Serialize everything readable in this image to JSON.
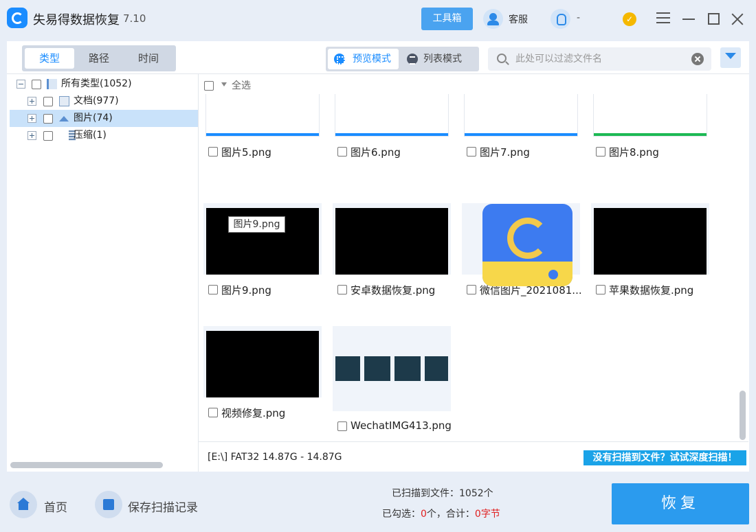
{
  "app": {
    "title": "失易得数据恢复",
    "version": "7.10"
  },
  "header": {
    "toolbox_label": "工具箱",
    "service_label": "客服",
    "qq_label": "-",
    "vip_glyph": "✓"
  },
  "side_tabs": [
    {
      "label": "类型",
      "active": true
    },
    {
      "label": "路径",
      "active": false
    },
    {
      "label": "时间",
      "active": false
    }
  ],
  "view_modes": [
    {
      "label": "预览模式",
      "active": true
    },
    {
      "label": "列表模式",
      "active": false
    }
  ],
  "search": {
    "placeholder": "此处可以过滤文件名",
    "value": ""
  },
  "tree": {
    "root": {
      "label": "所有类型(1052)"
    },
    "children": [
      {
        "label": "文档(977)",
        "selected": false
      },
      {
        "label": "图片(74)",
        "selected": true
      },
      {
        "label": "压缩(1)",
        "selected": false
      }
    ]
  },
  "grid": {
    "select_all_label": "全选",
    "files": [
      {
        "name": "图片5.png",
        "thumb": "screenshot"
      },
      {
        "name": "图片6.png",
        "thumb": "screenshot"
      },
      {
        "name": "图片7.png",
        "thumb": "screenshot"
      },
      {
        "name": "图片8.png",
        "thumb": "screenshot"
      },
      {
        "name": "图片9.png",
        "thumb": "black"
      },
      {
        "name": "安卓数据恢复.png",
        "thumb": "black"
      },
      {
        "name": "微信图片_2021081...",
        "thumb": "app-icon"
      },
      {
        "name": "苹果数据恢复.png",
        "thumb": "black"
      },
      {
        "name": "视频修复.png",
        "thumb": "black"
      },
      {
        "name": "WechatIMG413.png",
        "thumb": "dark-slides"
      }
    ],
    "tooltip": "图片9.png"
  },
  "status": {
    "disk_info": "[E:\\] FAT32 14.87G - 14.87G",
    "deep_scan_label": "没有扫描到文件？试试深度扫描！"
  },
  "footer": {
    "home_label": "首页",
    "save_label": "保存扫描记录",
    "scanned_prefix": "已扫描到文件：",
    "scanned_count": "1052个",
    "selected_prefix": "已勾选：",
    "selected_count": "0",
    "count_unit": "个，合计：",
    "selected_size": "0字节",
    "recover_label": "恢复"
  },
  "colors": {
    "accent": "#1a8cff",
    "recover": "#2b9bee",
    "deep_scan": "#1aa3e8",
    "highlight": "#e02020"
  }
}
